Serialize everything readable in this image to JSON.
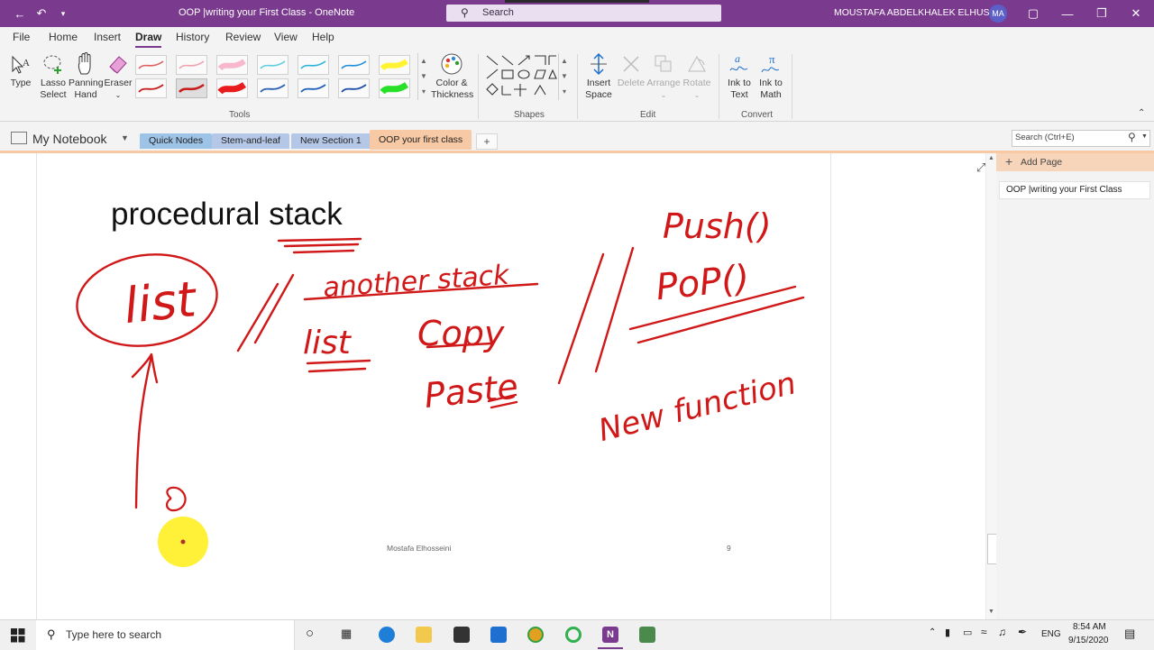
{
  "window": {
    "title": "OOP |writing your First Class  -  OneNote",
    "search_placeholder": "Search",
    "user_name": "MOUSTAFA ABDELKHALEK ELHUSSEI",
    "user_initials": "MA",
    "accent": "#7a3a8e"
  },
  "ribbon_tabs": [
    "File",
    "Home",
    "Insert",
    "Draw",
    "History",
    "Review",
    "View",
    "Help"
  ],
  "active_tab": "Draw",
  "tools": {
    "type": "Type",
    "lasso_1": "Lasso",
    "lasso_2": "Select",
    "panning_1": "Panning",
    "panning_2": "Hand",
    "eraser": "Eraser",
    "color_1": "Color &",
    "color_2": "Thickness",
    "group": "Tools"
  },
  "pens": {
    "top": [
      "#e06060",
      "#f0a0b0",
      "#f6a8c0",
      "#5ccfe0",
      "#28b4d8",
      "#1f8fdc",
      "#fff200"
    ],
    "bottom": [
      "#c81c1c",
      "#c81c1c",
      "#e81c1c",
      "#2a5fb4",
      "#1f5fbd",
      "#1e4fa8",
      "#28e028"
    ]
  },
  "shapes_group": "Shapes",
  "edit": {
    "insert_space_1": "Insert",
    "insert_space_2": "Space",
    "delete": "Delete",
    "arrange": "Arrange",
    "rotate": "Rotate",
    "group": "Edit"
  },
  "convert": {
    "ink_text_1": "Ink to",
    "ink_text_2": "Text",
    "ink_math_1": "Ink to",
    "ink_math_2": "Math",
    "group": "Convert"
  },
  "notebook": {
    "name": "My Notebook",
    "sections": [
      {
        "label": "Quick Nodes",
        "color": "#9dc3e6"
      },
      {
        "label": "Stem-and-leaf",
        "color": "#b4c7e7"
      },
      {
        "label": "New Section 1",
        "color": "#b4c7e7"
      },
      {
        "label": "OOP your first class",
        "color": "#f7c9a4"
      }
    ],
    "add_section": "+",
    "page_search": "Search (Ctrl+E)"
  },
  "page": {
    "title": "procedural stack",
    "footer_author": "Mostafa Elhosseini",
    "footer_page": "9",
    "ink_words": [
      "list",
      "another stack",
      "list",
      "Copy",
      "Paste",
      "Push()",
      "PoP()",
      "New function"
    ],
    "ink_color": "#d01818"
  },
  "pages_pane": {
    "add_page": "Add Page",
    "pages": [
      "OOP |writing your First Class"
    ]
  },
  "taskbar": {
    "search_placeholder": "Type here to search",
    "lang": "ENG",
    "time": "8:54 AM",
    "date": "9/15/2020"
  }
}
